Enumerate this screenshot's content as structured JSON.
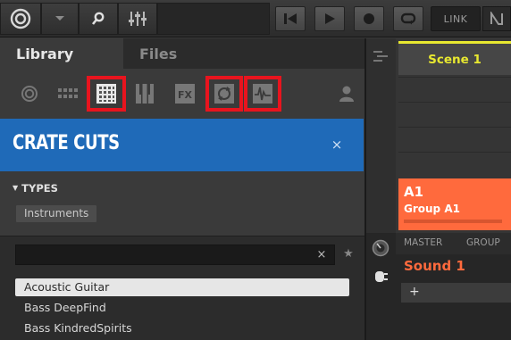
{
  "toolbar": {
    "link_label": "LINK"
  },
  "browser": {
    "tabs": [
      {
        "label": "Library",
        "active": true
      },
      {
        "label": "Files",
        "active": false
      }
    ],
    "filter_icons": [
      {
        "name": "all-instances-icon",
        "highlighted": false
      },
      {
        "name": "instrument-icon",
        "highlighted": false
      },
      {
        "name": "group-icon",
        "highlighted": true
      },
      {
        "name": "sound-icon",
        "highlighted": false
      },
      {
        "name": "effect-icon",
        "highlighted": false
      },
      {
        "name": "loop-icon",
        "highlighted": true
      },
      {
        "name": "one-shot-icon",
        "highlighted": true
      }
    ],
    "product": {
      "title": "CRATE CUTS",
      "close": "×"
    },
    "types_header": "TYPES",
    "type_tags": [
      "Instruments"
    ],
    "search": {
      "value": "",
      "clear": "×",
      "star": "★"
    },
    "results": [
      {
        "label": "Acoustic Guitar",
        "selected": true
      },
      {
        "label": "Bass DeepFind",
        "selected": false
      },
      {
        "label": "Bass KindredSpirits",
        "selected": false
      }
    ]
  },
  "arranger": {
    "scene_label": "Scene 1",
    "group_id": "A1",
    "group_name": "Group A1"
  },
  "mix": {
    "header_items": [
      "MASTER",
      "GROUP"
    ],
    "sound_name": "Sound 1",
    "add_label": "+"
  },
  "colors": {
    "accent_blue": "#1f6ab8",
    "highlight_red": "#e8141e",
    "scene_yellow": "#e8e830",
    "group_orange": "#ff6a3d"
  }
}
